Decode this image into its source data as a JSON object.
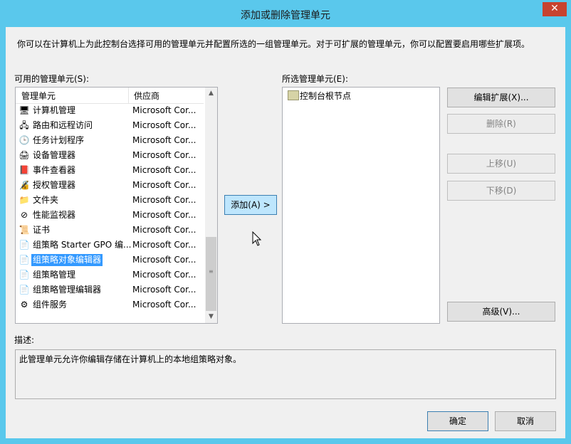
{
  "window": {
    "title": "添加或删除管理单元",
    "close_glyph": "✕"
  },
  "intro": "你可以在计算机上为此控制台选择可用的管理单元并配置所选的一组管理单元。对于可扩展的管理单元，你可以配置要启用哪些扩展项。",
  "available": {
    "label": "可用的管理单元(S):",
    "col_name": "管理单元",
    "col_vendor": "供应商",
    "items": [
      {
        "name": "计算机管理",
        "vendor": "Microsoft Cor...",
        "icon": "computer-management-icon",
        "glyph": "🖥"
      },
      {
        "name": "路由和远程访问",
        "vendor": "Microsoft Cor...",
        "icon": "routing-icon",
        "glyph": "🖧"
      },
      {
        "name": "任务计划程序",
        "vendor": "Microsoft Cor...",
        "icon": "task-scheduler-icon",
        "glyph": "🕒"
      },
      {
        "name": "设备管理器",
        "vendor": "Microsoft Cor...",
        "icon": "device-manager-icon",
        "glyph": "🖨"
      },
      {
        "name": "事件查看器",
        "vendor": "Microsoft Cor...",
        "icon": "event-viewer-icon",
        "glyph": "📕"
      },
      {
        "name": "授权管理器",
        "vendor": "Microsoft Cor...",
        "icon": "authorization-manager-icon",
        "glyph": "🔏"
      },
      {
        "name": "文件夹",
        "vendor": "Microsoft Cor...",
        "icon": "folder-icon",
        "glyph": "📁"
      },
      {
        "name": "性能监视器",
        "vendor": "Microsoft Cor...",
        "icon": "performance-monitor-icon",
        "glyph": "⊘"
      },
      {
        "name": "证书",
        "vendor": "Microsoft Cor...",
        "icon": "certificate-icon",
        "glyph": "📜"
      },
      {
        "name": "组策略 Starter GPO 编...",
        "vendor": "Microsoft Cor...",
        "icon": "starter-gpo-icon",
        "glyph": "📄"
      },
      {
        "name": "组策略对象编辑器",
        "vendor": "Microsoft Cor...",
        "icon": "gpo-editor-icon",
        "glyph": "📄"
      },
      {
        "name": "组策略管理",
        "vendor": "Microsoft Cor...",
        "icon": "gp-management-icon",
        "glyph": "📄"
      },
      {
        "name": "组策略管理编辑器",
        "vendor": "Microsoft Cor...",
        "icon": "gp-management-editor-icon",
        "glyph": "📄"
      },
      {
        "name": "组件服务",
        "vendor": "Microsoft Cor...",
        "icon": "component-services-icon",
        "glyph": "⚙"
      }
    ]
  },
  "add_button": "添加(A) >",
  "selected": {
    "label": "所选管理单元(E):",
    "root": "控制台根节点"
  },
  "buttons": {
    "edit_ext": "编辑扩展(X)...",
    "remove": "删除(R)",
    "move_up": "上移(U)",
    "move_down": "下移(D)",
    "advanced": "高级(V)...",
    "ok": "确定",
    "cancel": "取消"
  },
  "description": {
    "label": "描述:",
    "text": "此管理单元允许你编辑存储在计算机上的本地组策略对象。"
  }
}
